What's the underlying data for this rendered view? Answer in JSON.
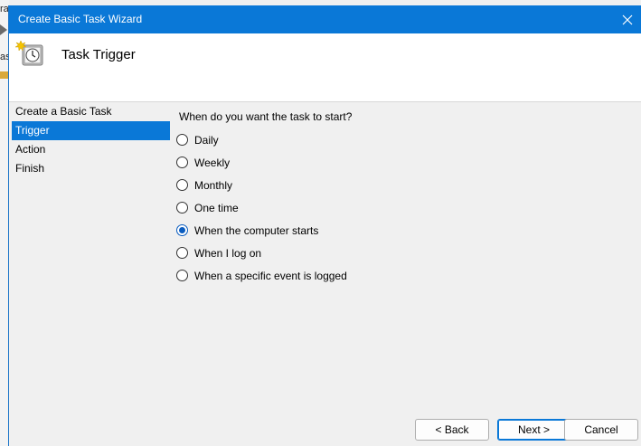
{
  "background_app": {
    "fragments": [
      "ra",
      "as"
    ]
  },
  "window": {
    "title": "Create Basic Task Wizard",
    "close_icon": "close-icon",
    "accent_color": "#0a78d7"
  },
  "header": {
    "title": "Task Trigger",
    "icon": "task-scheduler-clock-icon"
  },
  "nav": {
    "items": [
      {
        "label": "Create a Basic Task",
        "selected": false
      },
      {
        "label": "Trigger",
        "selected": true
      },
      {
        "label": "Action",
        "selected": false
      },
      {
        "label": "Finish",
        "selected": false
      }
    ]
  },
  "main": {
    "question": "When do you want the task to start?",
    "options": [
      {
        "label": "Daily",
        "checked": false
      },
      {
        "label": "Weekly",
        "checked": false
      },
      {
        "label": "Monthly",
        "checked": false
      },
      {
        "label": "One time",
        "checked": false
      },
      {
        "label": "When the computer starts",
        "checked": true
      },
      {
        "label": "When I log on",
        "checked": false
      },
      {
        "label": "When a specific event is logged",
        "checked": false
      }
    ]
  },
  "buttons": {
    "back": "< Back",
    "next": "Next >",
    "cancel": "Cancel"
  }
}
